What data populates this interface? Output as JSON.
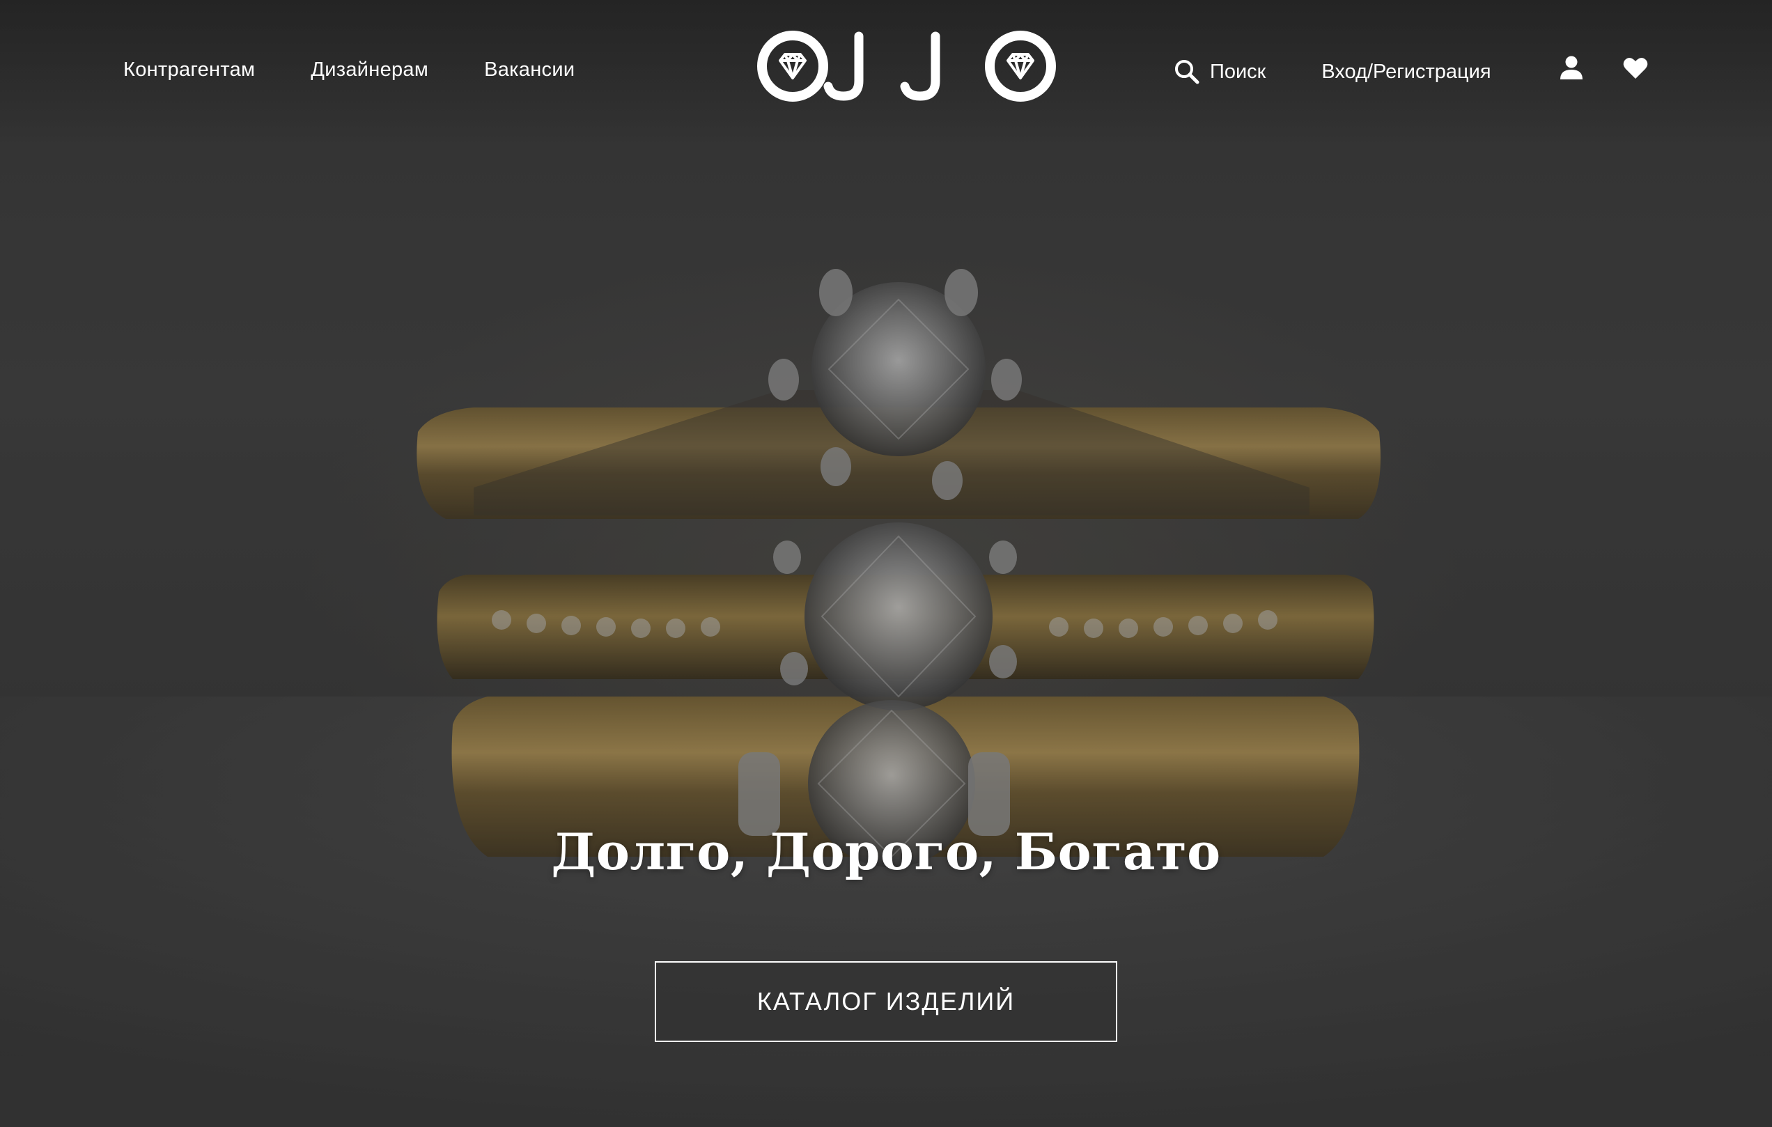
{
  "header": {
    "nav_left": [
      "Контрагентам",
      "Дизайнерам",
      "Вакансии"
    ],
    "logo_text": "OJJO",
    "search_label": "Поиск",
    "login_label": "Вход/Регистрация",
    "icons": [
      "search-icon",
      "user-icon",
      "heart-icon"
    ]
  },
  "hero": {
    "title": "Долго, Дорого, Богато",
    "button_label": "КАТАЛОГ ИЗДЕЛИЙ"
  },
  "colors": {
    "text": "#ffffff",
    "background": "#3b3b3b",
    "gold": "#b08a3c"
  }
}
